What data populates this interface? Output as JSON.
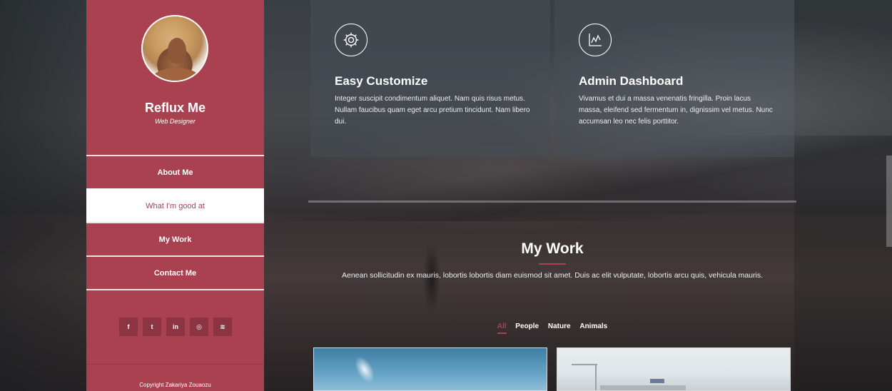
{
  "sidebar": {
    "name": "Reflux Me",
    "role": "Web Designer",
    "nav": [
      {
        "label": "About Me",
        "active": false
      },
      {
        "label": "What I'm good at",
        "active": true
      },
      {
        "label": "My Work",
        "active": false
      },
      {
        "label": "Contact Me",
        "active": false
      }
    ],
    "social_icons": [
      "facebook-icon",
      "twitter-icon",
      "linkedin-icon",
      "dribbble-icon",
      "rss-icon"
    ],
    "social_glyphs": [
      "f",
      "t",
      "in",
      "◎",
      "≋"
    ],
    "copyright": "Copyright Zakariya Zouaozu",
    "accent_color": "#a94150"
  },
  "features": [
    {
      "icon": "gear-icon",
      "title": "Easy Customize",
      "text": "Integer suscipit condimentum aliquet. Nam quis risus metus. Nullam faucibus quam eget arcu pretium tincidunt. Nam libero dui."
    },
    {
      "icon": "chart-icon",
      "title": "Admin Dashboard",
      "text": "Vivamus et dui a massa venenatis fringilla. Proin lacus massa, eleifend sed fermentum in, dignissim vel metus. Nunc accumsan leo nec felis porttitor."
    }
  ],
  "work": {
    "title": "My Work",
    "description": "Aenean sollicitudin ex mauris, lobortis lobortis diam euismod sit amet. Duis ac elit vulputate, lobortis arcu quis, vehicula mauris.",
    "filters": [
      {
        "label": "All",
        "active": true
      },
      {
        "label": "People",
        "active": false
      },
      {
        "label": "Nature",
        "active": false
      },
      {
        "label": "Animals",
        "active": false
      }
    ]
  }
}
